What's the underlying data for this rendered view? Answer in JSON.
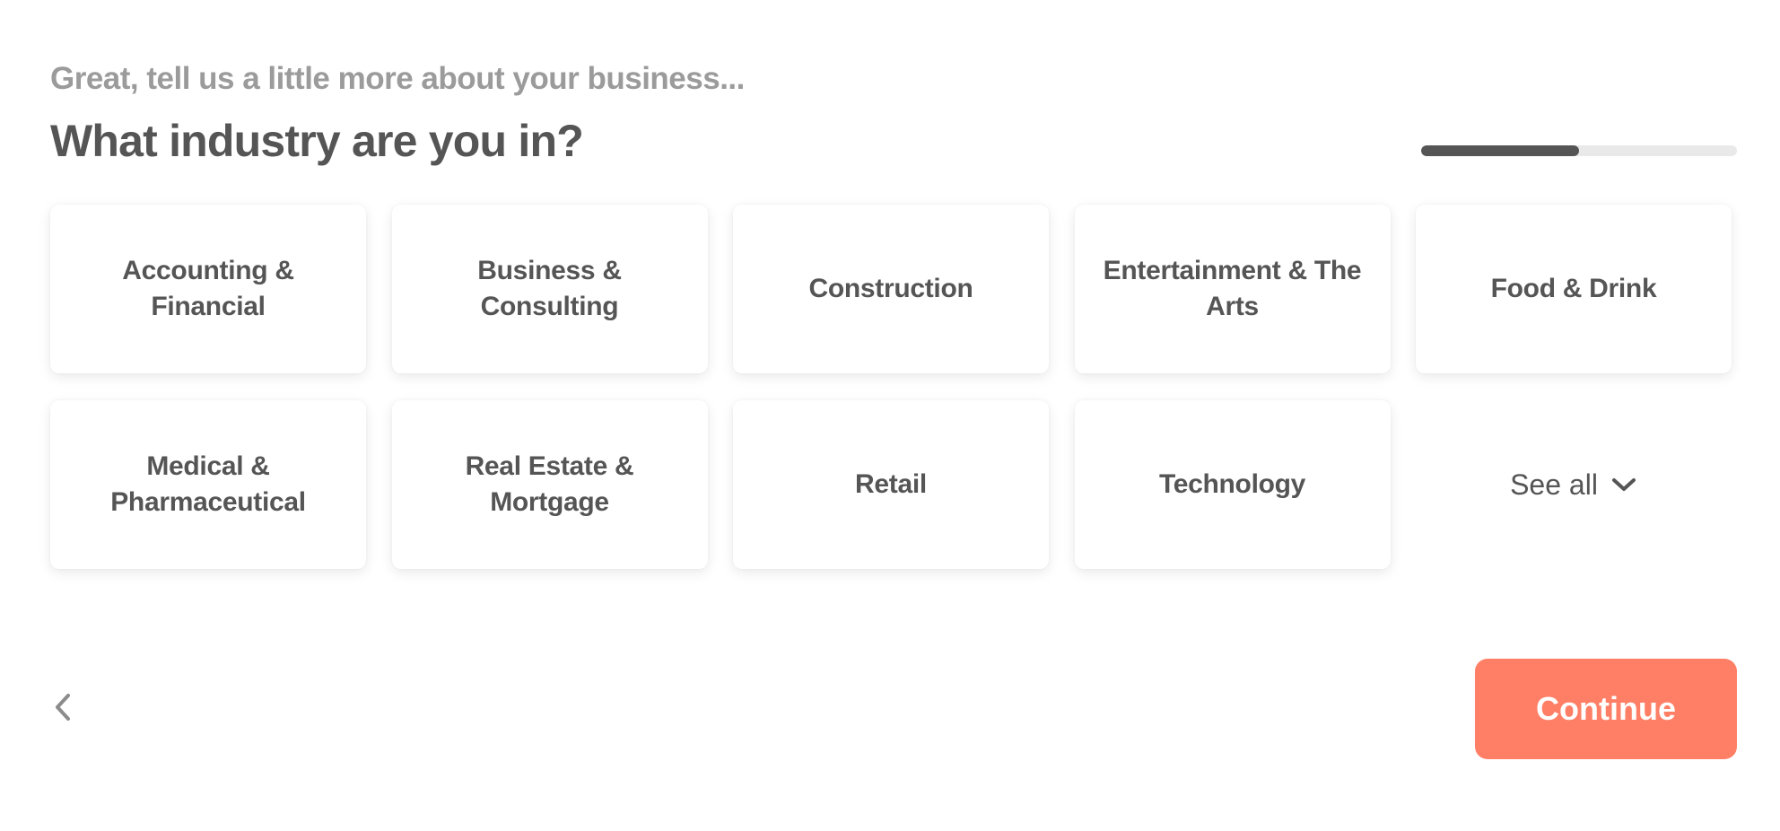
{
  "header": {
    "subtitle": "Great, tell us a little more about your business...",
    "title": "What industry are you in?"
  },
  "progress": {
    "value_percent": 50,
    "fill_color": "#555555",
    "track_color": "#e9e9e9"
  },
  "industries": [
    {
      "label": "Accounting & Financial"
    },
    {
      "label": "Business & Consulting"
    },
    {
      "label": "Construction"
    },
    {
      "label": "Entertainment & The Arts"
    },
    {
      "label": "Food & Drink"
    },
    {
      "label": "Medical & Pharmaceutical"
    },
    {
      "label": "Real Estate & Mortgage"
    },
    {
      "label": "Retail"
    },
    {
      "label": "Technology"
    }
  ],
  "see_all": {
    "label": "See all",
    "icon": "chevron-down-icon"
  },
  "footer": {
    "back_icon": "chevron-left-icon",
    "continue_label": "Continue",
    "accent_color": "#ff7f66"
  }
}
